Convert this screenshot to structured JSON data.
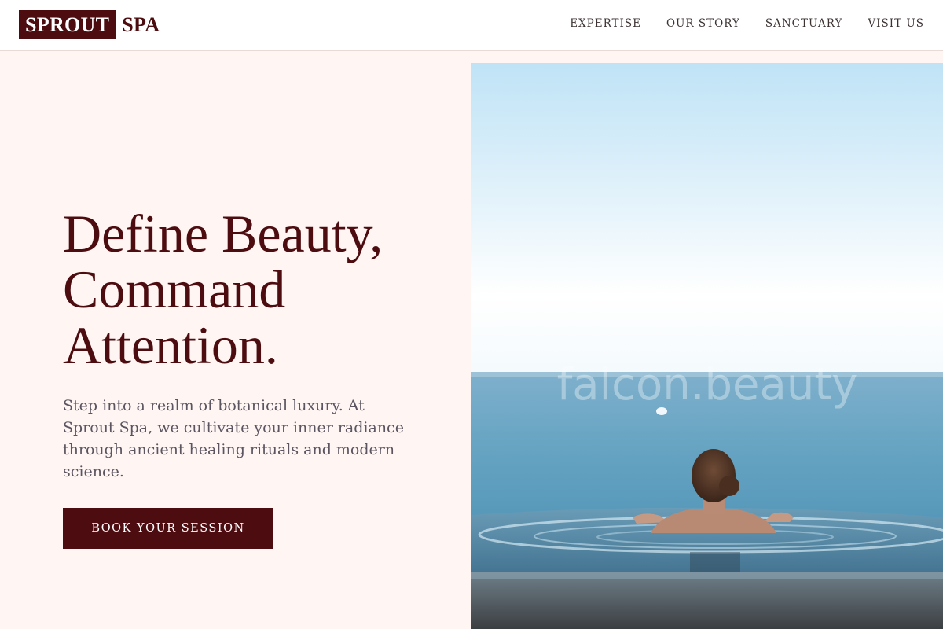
{
  "brand": {
    "logo_box": "SPROUT",
    "logo_rest": "SPA",
    "color": "#4d0d10"
  },
  "nav": {
    "items": [
      "EXPERTISE",
      "OUR STORY",
      "SANCTUARY",
      "VISIT US"
    ]
  },
  "hero": {
    "title_lines": [
      "Define Beauty,",
      "Command",
      "Attention."
    ],
    "description": "Step into a realm of botanical luxury. At Sprout Spa, we cultivate your inner radiance through ancient healing rituals and modern science.",
    "cta_label": "BOOK YOUR SESSION",
    "image_watermark": "falcon.beauty"
  }
}
